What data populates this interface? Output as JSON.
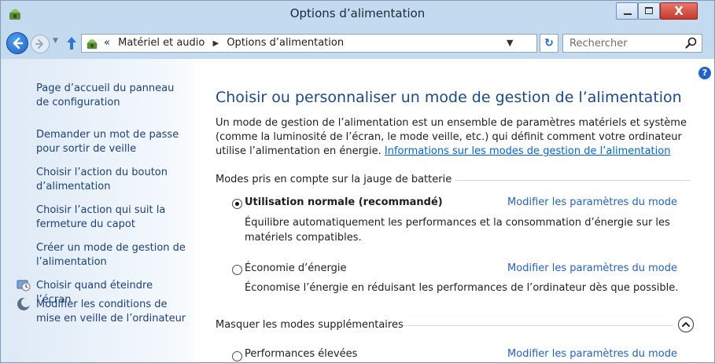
{
  "window": {
    "title": "Options d’alimentation",
    "controls": {
      "minimize": "minimize",
      "maximize": "maximize",
      "close": "X"
    }
  },
  "navigation": {
    "address": {
      "overflow": "«",
      "crumbs": [
        "Matériel et audio",
        "Options d’alimentation"
      ]
    },
    "search": {
      "placeholder": "Rechercher"
    }
  },
  "sidebar": {
    "items": [
      {
        "label": "Page d’accueil du panneau de configuration",
        "icon": null
      },
      {
        "label": "Demander un mot de passe pour sortir de veille",
        "icon": null
      },
      {
        "label": "Choisir l’action du bouton d’alimentation",
        "icon": null
      },
      {
        "label": "Choisir l’action qui suit la fermeture du capot",
        "icon": null
      },
      {
        "label": "Créer un mode de gestion de l’alimentation",
        "icon": null
      },
      {
        "label": "Choisir quand éteindre l’écran",
        "icon": "monitor-clock-icon"
      },
      {
        "label": "Modifier les conditions de mise en veille de l’ordinateur",
        "icon": "moon-icon"
      }
    ]
  },
  "main": {
    "help": "?",
    "title": "Choisir ou personnaliser un mode de gestion de l’alimentation",
    "intro": "Un mode de gestion de l’alimentation est un ensemble de paramètres matériels et système (comme la luminosité de l’écran, le mode veille, etc.) qui définit comment votre ordinateur utilise l’alimentation en énergie.",
    "intro_link": "Informations sur les modes de gestion de l’alimentation",
    "battery_group": {
      "header": "Modes pris en compte sur la jauge de batterie",
      "plans": [
        {
          "name": "Utilisation normale (recommandé)",
          "selected": true,
          "change_link": "Modifier les paramètres du mode",
          "description": "Équilibre automatiquement les performances et la consommation d’énergie sur les matériels compatibles."
        },
        {
          "name": "Économie d’énergie",
          "selected": false,
          "change_link": "Modifier les paramètres du mode",
          "description": "Économise l’énergie en réduisant les performances de l’ordinateur dès que possible."
        }
      ]
    },
    "extra_group": {
      "header": "Masquer les modes supplémentaires",
      "plans": [
        {
          "name": "Performances élevées",
          "selected": false,
          "change_link": "Modifier les paramètres du mode"
        }
      ]
    }
  },
  "colors": {
    "accent": "#1f63c4",
    "title_text": "#1a4a86",
    "sidebar_link": "#1f3f7a",
    "frame": "#c4daef"
  }
}
